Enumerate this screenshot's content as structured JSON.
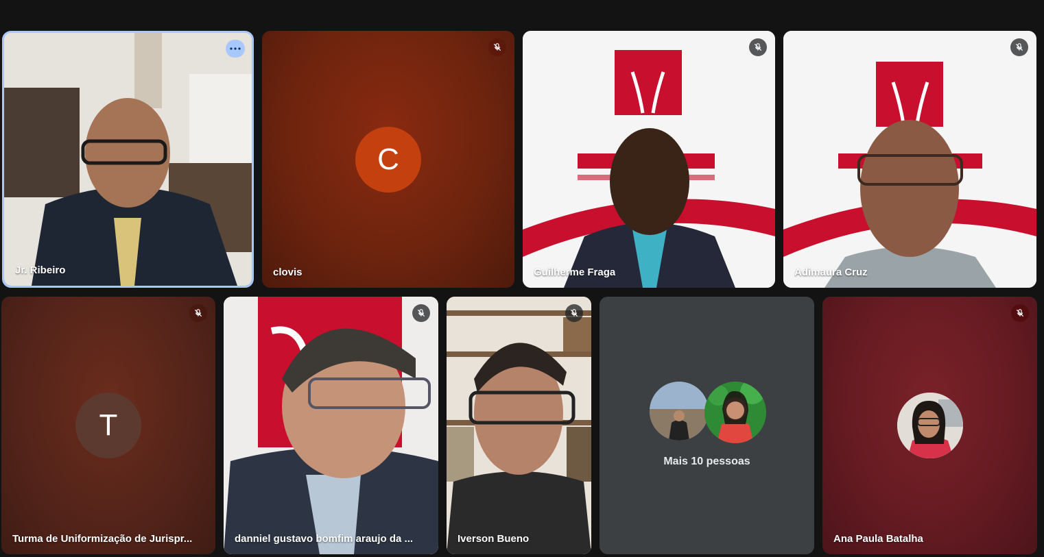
{
  "tiles": {
    "jr_ribeiro": {
      "name": "Jr. Ribeiro"
    },
    "clovis": {
      "name": "clovis",
      "initial": "C"
    },
    "guilherme": {
      "name": "Guilherme Fraga"
    },
    "adimaura": {
      "name": "Adimaura Cruz"
    },
    "turma": {
      "name": "Turma de Uniformização de Jurispr...",
      "initial": "T"
    },
    "danniel": {
      "name": "danniel gustavo bomfim araujo da ..."
    },
    "iverson": {
      "name": "Iverson Bueno"
    },
    "others": {
      "label": "Mais 10 pessoas"
    },
    "ana": {
      "name": "Ana Paula Batalha"
    }
  },
  "icons": {
    "more": "more-options-icon",
    "mic_off": "mic-off-icon"
  },
  "colors": {
    "background": "#131313",
    "active_border": "#a8c7fa",
    "clovis_avatar": "#c5400f",
    "turma_avatar": "#5d3a2f",
    "tile_gray": "#3c4043"
  }
}
